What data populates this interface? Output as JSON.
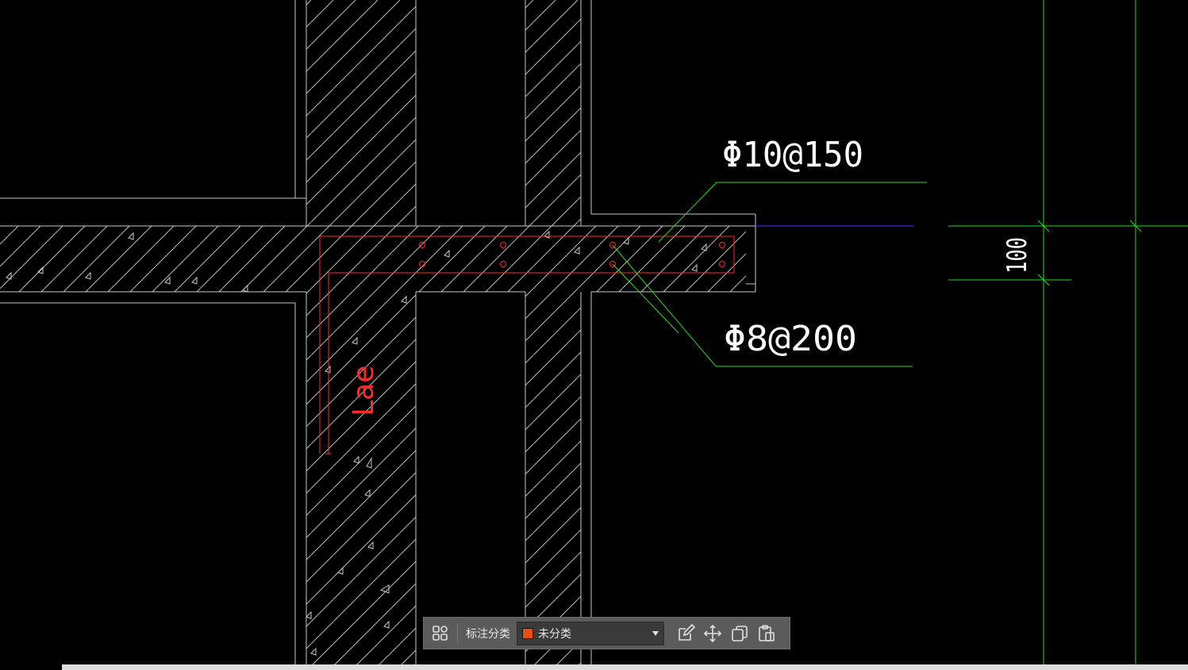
{
  "drawing": {
    "rebar_top_label": "Φ10@150",
    "rebar_bottom_label": "Φ8@200",
    "anchor_label": "Lae",
    "dimension_value": "100"
  },
  "toolbar": {
    "category_label": "标注分类",
    "category_value": "未分类",
    "category_color": "#e8500a"
  },
  "colors": {
    "background": "#000000",
    "wall_line": "#c8c8c8",
    "rebar": "#ff2a2a",
    "leader": "#22dd22",
    "axis": "#3a3aff"
  }
}
